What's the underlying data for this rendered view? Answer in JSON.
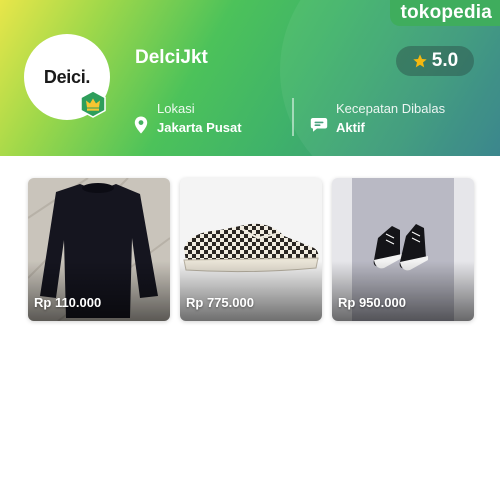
{
  "brand": {
    "name": "tokopedia"
  },
  "shop": {
    "avatar_text": "Deici.",
    "name": "DelciJkt",
    "rating": "5.0",
    "location_label": "Lokasi",
    "location_value": "Jakarta Pusat",
    "response_label": "Kecepatan Dibalas",
    "response_value": "Aktif"
  },
  "products": [
    {
      "price": "Rp 110.000",
      "image": "black-sweater"
    },
    {
      "price": "Rp 775.000",
      "image": "checkered-sneaker"
    },
    {
      "price": "Rp 950.000",
      "image": "black-high-top-sneakers"
    }
  ],
  "colors": {
    "brand_green": "#34a853",
    "rating_star": "#f5b400",
    "badge_green": "#2e9e5b"
  }
}
